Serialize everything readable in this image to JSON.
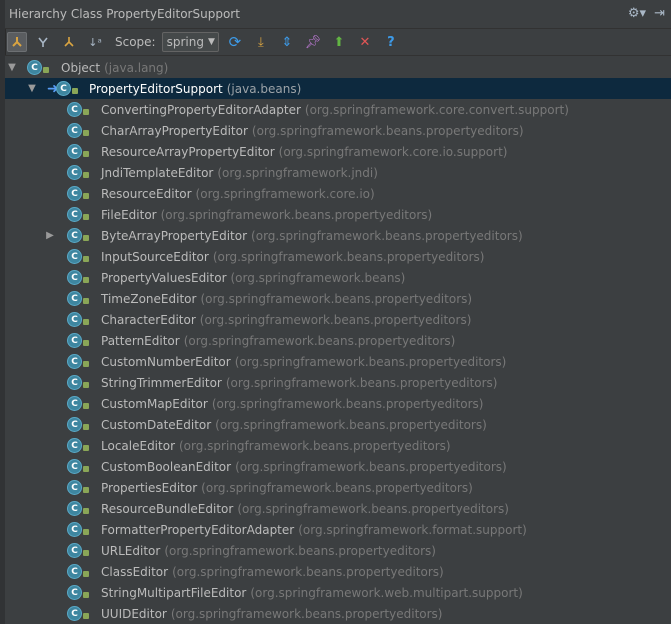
{
  "window": {
    "title": "Hierarchy Class PropertyEditorSupport"
  },
  "toolbar": {
    "scope_label": "Scope:",
    "scope_value": "spring",
    "buttons": [
      "class-hierarchy-icon",
      "supertypes-icon",
      "subtypes-icon",
      "sort-alpha-icon",
      "refresh-icon",
      "export-icon",
      "expand-all-icon",
      "pin-icon",
      "open-in-new-tab-icon",
      "close-icon",
      "help-icon"
    ]
  },
  "tree": {
    "root": {
      "name": "Object",
      "package": "(java.lang)"
    },
    "selected": {
      "name": "PropertyEditorSupport",
      "package": "(java.beans)"
    },
    "children": [
      {
        "name": "ConvertingPropertyEditorAdapter",
        "package": "(org.springframework.core.convert.support)"
      },
      {
        "name": "CharArrayPropertyEditor",
        "package": "(org.springframework.beans.propertyeditors)"
      },
      {
        "name": "ResourceArrayPropertyEditor",
        "package": "(org.springframework.core.io.support)"
      },
      {
        "name": "JndiTemplateEditor",
        "package": "(org.springframework.jndi)"
      },
      {
        "name": "ResourceEditor",
        "package": "(org.springframework.core.io)"
      },
      {
        "name": "FileEditor",
        "package": "(org.springframework.beans.propertyeditors)"
      },
      {
        "name": "ByteArrayPropertyEditor",
        "package": "(org.springframework.beans.propertyeditors)"
      },
      {
        "name": "InputSourceEditor",
        "package": "(org.springframework.beans.propertyeditors)"
      },
      {
        "name": "PropertyValuesEditor",
        "package": "(org.springframework.beans)"
      },
      {
        "name": "TimeZoneEditor",
        "package": "(org.springframework.beans.propertyeditors)"
      },
      {
        "name": "CharacterEditor",
        "package": "(org.springframework.beans.propertyeditors)"
      },
      {
        "name": "PatternEditor",
        "package": "(org.springframework.beans.propertyeditors)"
      },
      {
        "name": "CustomNumberEditor",
        "package": "(org.springframework.beans.propertyeditors)"
      },
      {
        "name": "StringTrimmerEditor",
        "package": "(org.springframework.beans.propertyeditors)"
      },
      {
        "name": "CustomMapEditor",
        "package": "(org.springframework.beans.propertyeditors)"
      },
      {
        "name": "CustomDateEditor",
        "package": "(org.springframework.beans.propertyeditors)"
      },
      {
        "name": "LocaleEditor",
        "package": "(org.springframework.beans.propertyeditors)"
      },
      {
        "name": "CustomBooleanEditor",
        "package": "(org.springframework.beans.propertyeditors)"
      },
      {
        "name": "PropertiesEditor",
        "package": "(org.springframework.beans.propertyeditors)"
      },
      {
        "name": "ResourceBundleEditor",
        "package": "(org.springframework.beans.propertyeditors)"
      },
      {
        "name": "FormatterPropertyEditorAdapter",
        "package": "(org.springframework.format.support)"
      },
      {
        "name": "URLEditor",
        "package": "(org.springframework.beans.propertyeditors)"
      },
      {
        "name": "ClassEditor",
        "package": "(org.springframework.beans.propertyeditors)"
      },
      {
        "name": "StringMultipartFileEditor",
        "package": "(org.springframework.web.multipart.support)"
      },
      {
        "name": "UUIDEditor",
        "package": "(org.springframework.beans.propertyeditors)"
      }
    ]
  },
  "colors": {
    "background": "#3c3f41",
    "selection": "#0d293e",
    "class_icon": "#3e86a0",
    "package_text": "#787878"
  }
}
